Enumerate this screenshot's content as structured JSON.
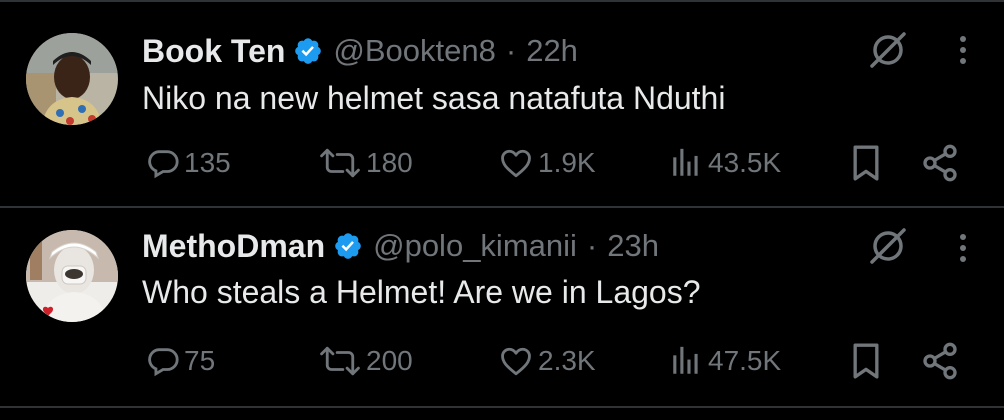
{
  "tweets": [
    {
      "display_name": "Book Ten",
      "handle": "@Bookten8",
      "separator": "·",
      "time": "22h",
      "text": "Niko na new helmet sasa natafuta Nduthi",
      "replies": "135",
      "retweets": "180",
      "likes": "1.9K",
      "views": "43.5K"
    },
    {
      "display_name": "MethoDman",
      "handle": "@polo_kimanii",
      "separator": "·",
      "time": "23h",
      "text": "Who steals a Helmet! Are we in Lagos?",
      "replies": "75",
      "retweets": "200",
      "likes": "2.3K",
      "views": "47.5K"
    }
  ],
  "icons": {
    "verified": "verified-badge-icon",
    "grok": "grok-icon",
    "more": "more-vertical-icon",
    "reply": "reply-icon",
    "retweet": "retweet-icon",
    "like": "heart-icon",
    "views": "views-icon",
    "bookmark": "bookmark-icon",
    "share": "share-icon"
  },
  "colors": {
    "background": "#000000",
    "primary_text": "#e7e9ea",
    "secondary_text": "#71767b",
    "verified_blue": "#1d9bf0",
    "divider": "#2f3336"
  }
}
